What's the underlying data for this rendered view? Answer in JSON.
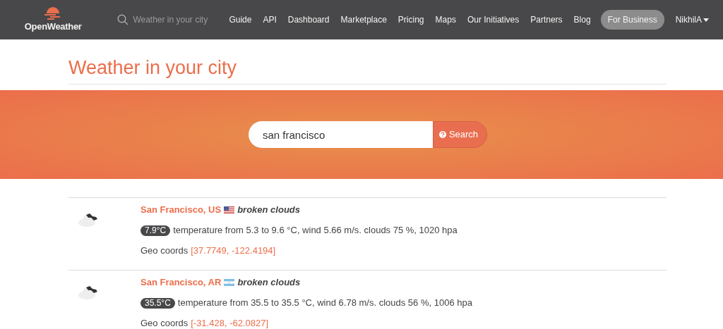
{
  "nav": {
    "logo": "OpenWeather",
    "search_placeholder": "Weather in your city",
    "links": [
      "Guide",
      "API",
      "Dashboard",
      "Marketplace",
      "Pricing",
      "Maps",
      "Our Initiatives",
      "Partners",
      "Blog"
    ],
    "business_button": "For Business",
    "user": "NikhilA"
  },
  "page_title": "Weather in your city",
  "search": {
    "value": "san francisco",
    "button": "Search"
  },
  "results": [
    {
      "city": "San Francisco, US",
      "kind": "us",
      "description": "broken clouds",
      "temp": "7.9°C",
      "details": "temperature from 5.3 to 9.6 °C, wind 5.66 m/s. clouds 75 %, 1020 hpa",
      "geo_label": "Geo coords",
      "coords": "[37.7749, -122.4194]"
    },
    {
      "city": "San Francisco, AR",
      "kind": "ar",
      "description": "broken clouds",
      "temp": "35.5°C",
      "details": "temperature from 35.5 to 35.5 °C, wind 6.78 m/s. clouds 56 %, 1006 hpa",
      "geo_label": "Geo coords",
      "coords": "[-31.428, -62.0827]"
    }
  ]
}
